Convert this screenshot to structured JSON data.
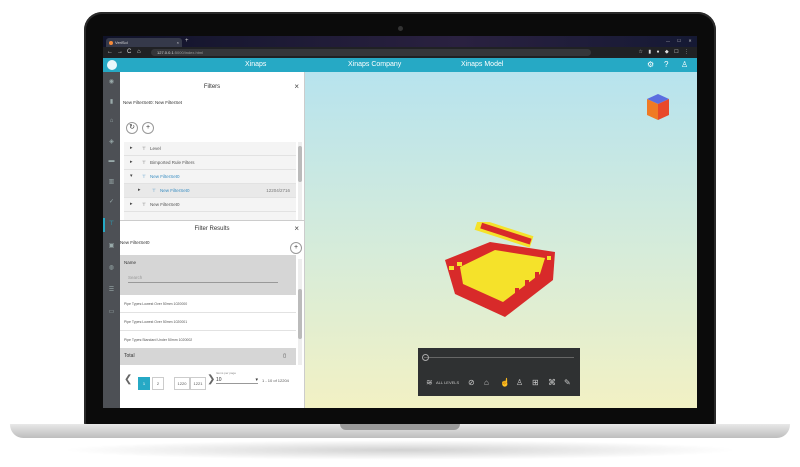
{
  "browser": {
    "tab_title": "VeriSol",
    "tab_close": "×",
    "new_tab": "+",
    "back": "←",
    "forward": "→",
    "reload": "C",
    "home": "⌂",
    "url_host": "127.0.0.1",
    "url_rest": ":5000/index.html"
  },
  "app": {
    "title_left": "Xinaps",
    "title_center": "Xinaps Company",
    "title_right": "Xinaps Model",
    "accent": "#26a9c5"
  },
  "filters": {
    "title": "Filters",
    "close": "×",
    "subtitle": "New FilterSet0: New FilterSet",
    "refresh": "↻",
    "add": "+",
    "tree": [
      {
        "label": "Level",
        "icon": "filter-icon"
      },
      {
        "label": "Bimported Rule Filters",
        "icon": "filter-icon"
      },
      {
        "label": "New FilterSet0",
        "icon": "filter-icon"
      },
      {
        "label": "New FilterSet0",
        "icon": "filter-icon",
        "count": "12204/2716"
      },
      {
        "label": "New FilterSet0",
        "icon": "filter-icon"
      }
    ]
  },
  "results": {
    "title": "Filter Results",
    "close": "×",
    "set_name": "New FilterSet0",
    "add": "+",
    "column": "Name",
    "search_placeholder": "Search",
    "rows": [
      "Pipe Types:Lowest Over 50mm 1020000",
      "Pipe Types:Lowest Over 50mm 1020001",
      "Pipe Types:Standard Under 50mm 1020002"
    ],
    "total_label": "Total",
    "pager": {
      "prev": "❮",
      "page1": "1",
      "page2": "2",
      "p3": "1220",
      "p4": "1221",
      "next": "❯",
      "per_page_label": "Items per page",
      "per_page": "10",
      "range": "1 - 10 of 12204"
    }
  },
  "toolbar": {
    "all_levels": "ALL LEVELS"
  }
}
